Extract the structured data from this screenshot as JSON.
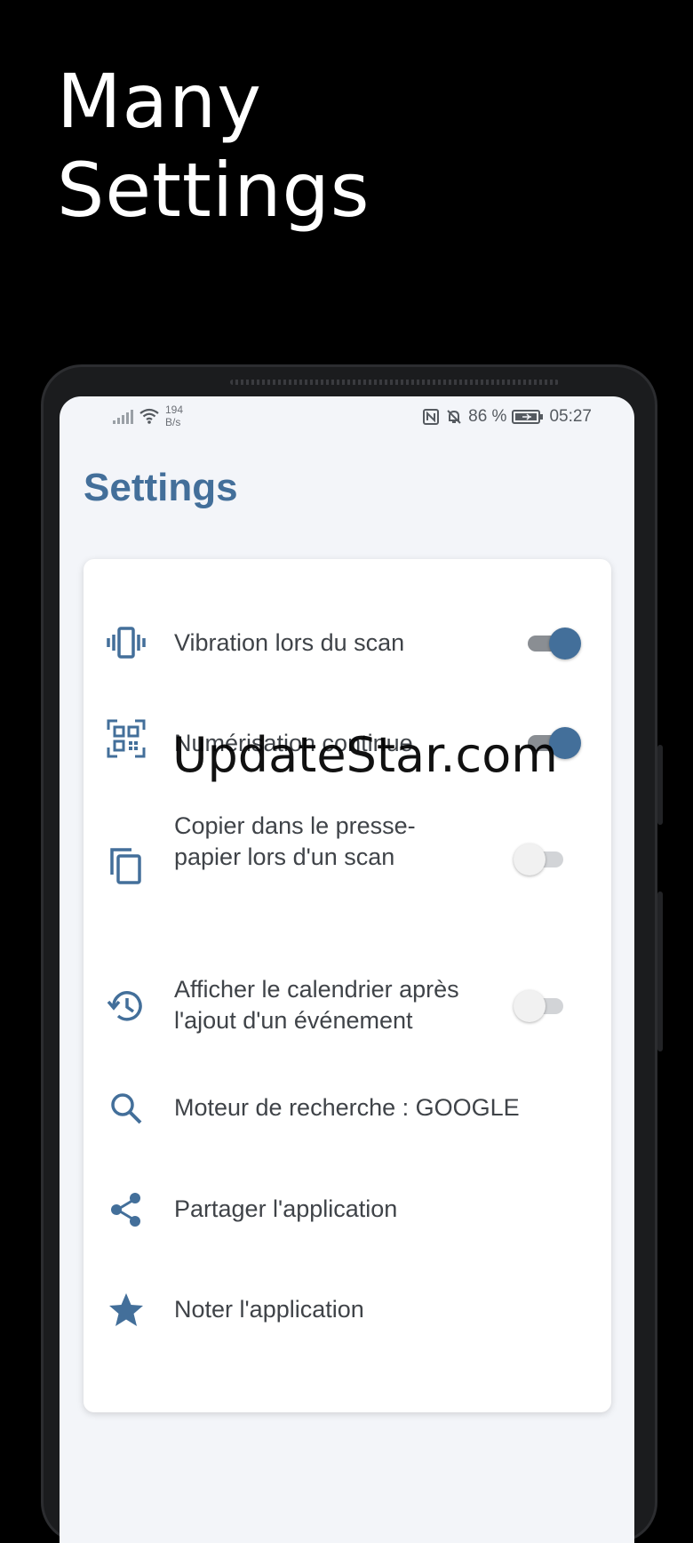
{
  "headline": {
    "line1": "Many",
    "line2": "Settings"
  },
  "status_bar": {
    "net_speed_value": "194",
    "net_speed_unit": "B/s",
    "battery": "86 %",
    "time": "05:27"
  },
  "page": {
    "title": "Settings"
  },
  "settings": [
    {
      "label": "Vibration lors du scan",
      "icon": "vibration-icon",
      "toggle": "on"
    },
    {
      "label": "Numérisation continue",
      "icon": "qr-code-icon",
      "toggle": "on"
    },
    {
      "label": "Copier dans le presse-papier lors d'un scan",
      "icon": "copy-icon",
      "toggle": "off"
    },
    {
      "label": "Afficher le calendrier après l'ajout d'un événement",
      "icon": "history-icon",
      "toggle": "off"
    },
    {
      "label": "Moteur de recherche : GOOGLE",
      "icon": "search-icon"
    },
    {
      "label": "Partager l'application",
      "icon": "share-icon"
    },
    {
      "label": "Noter l'application",
      "icon": "star-icon"
    }
  ],
  "watermark": "UpdateStar.com",
  "colors": {
    "accent": "#436f9a",
    "background": "#000000",
    "screen": "#f3f5f9",
    "card": "#ffffff"
  }
}
